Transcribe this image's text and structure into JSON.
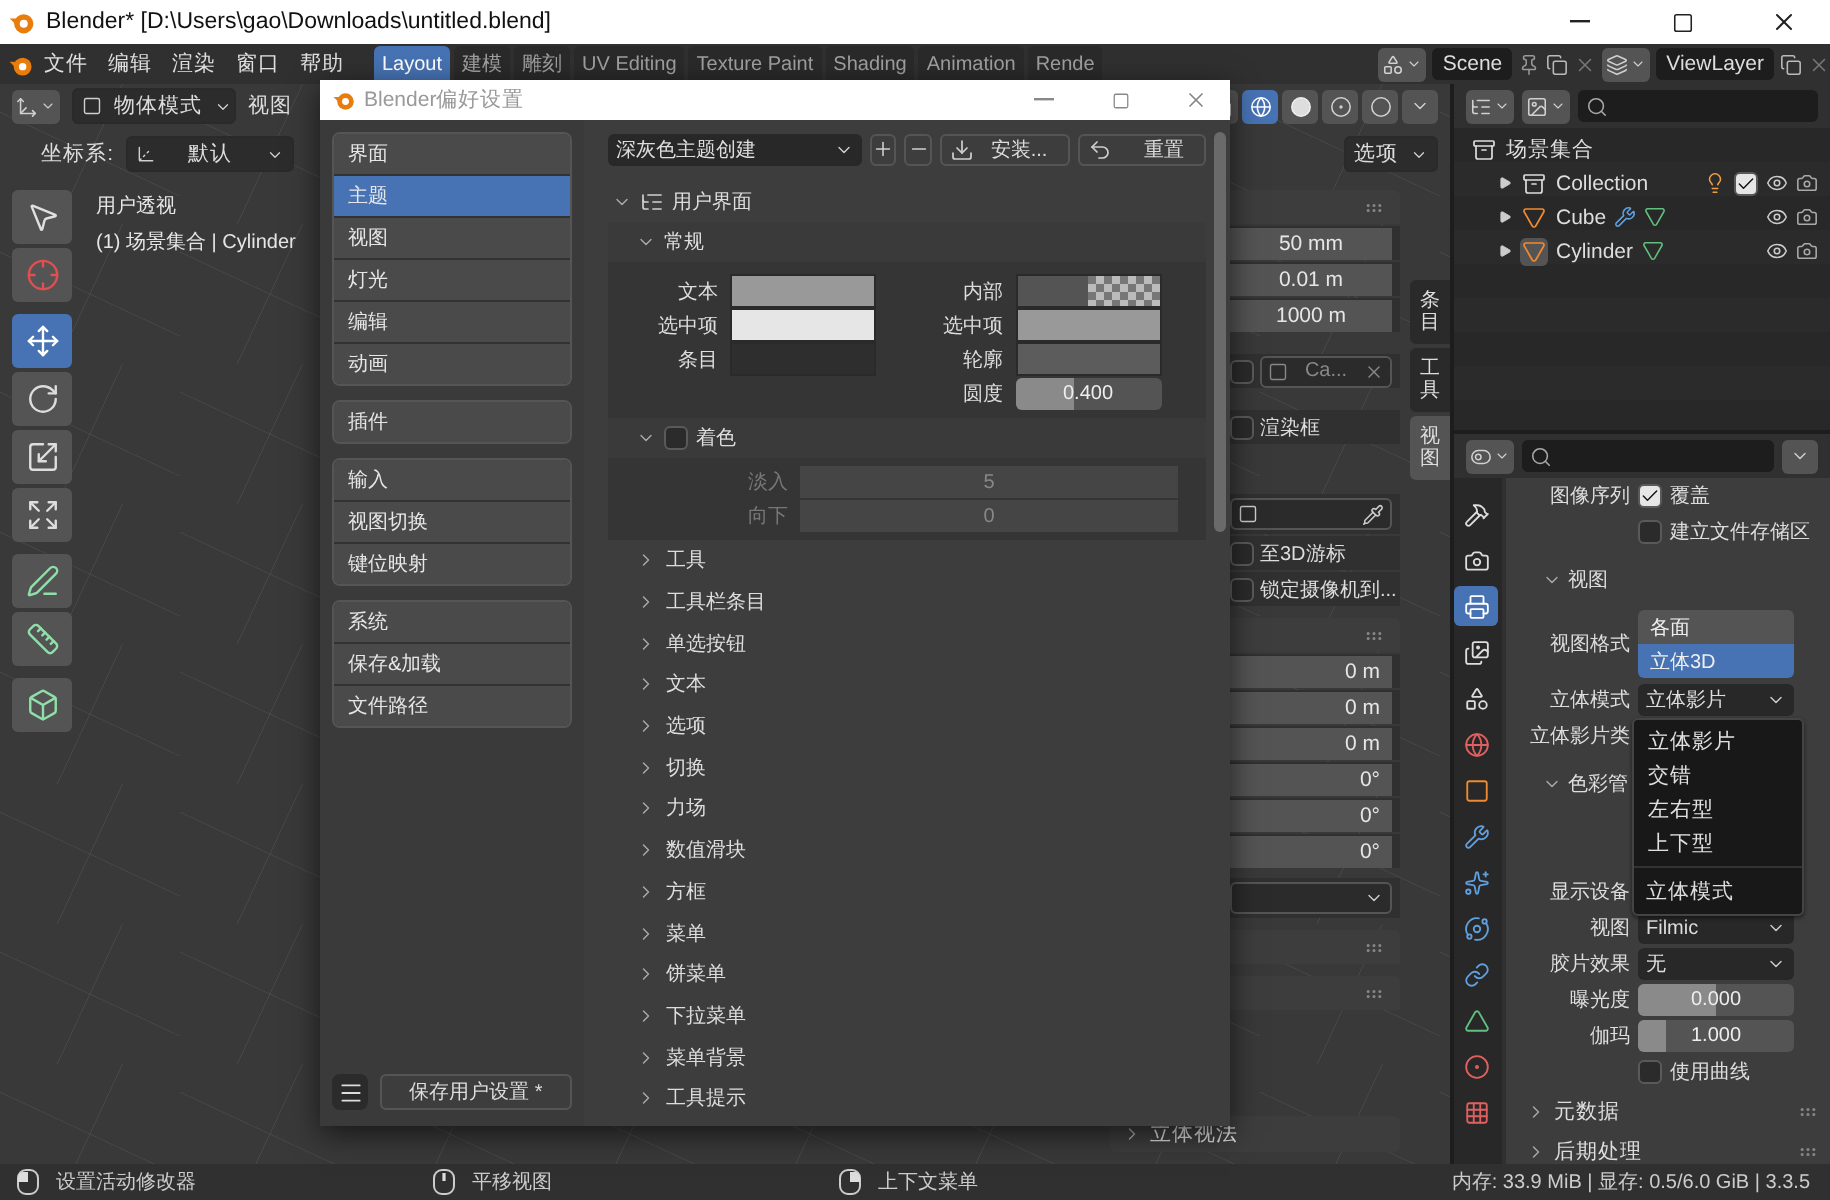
{
  "window": {
    "title": "Blender* [D:\\Users\\gao\\Downloads\\untitled.blend]"
  },
  "menu": [
    {
      "label": "文件"
    },
    {
      "label": "编辑"
    },
    {
      "label": "渲染"
    },
    {
      "label": "窗口"
    },
    {
      "label": "帮助"
    }
  ],
  "workspaces": [
    {
      "label": "Layout",
      "selected": true
    },
    {
      "label": "建模",
      "selected": false
    },
    {
      "label": "雕刻",
      "selected": false
    },
    {
      "label": "UV Editing",
      "selected": false
    },
    {
      "label": "Texture Paint",
      "selected": false
    },
    {
      "label": "Shading",
      "selected": false
    },
    {
      "label": "Animation",
      "selected": false
    },
    {
      "label": "Rende",
      "selected": false
    }
  ],
  "scene": "Scene",
  "view_layer": "ViewLayer",
  "viewport": {
    "mode": "物体模式",
    "view_menu": "视图",
    "coord_label": "坐标系:",
    "coord_value": "默认",
    "options": "选项",
    "tool_groups": [
      [
        {
          "kind": "select",
          "selected": false
        },
        {
          "kind": "cursor",
          "selected": false
        }
      ],
      [
        {
          "kind": "move",
          "selected": true
        },
        {
          "kind": "rotate",
          "selected": false
        },
        {
          "kind": "scale",
          "selected": false
        },
        {
          "kind": "transform",
          "selected": false
        }
      ],
      [
        {
          "kind": "annotate",
          "selected": false
        },
        {
          "kind": "measure",
          "selected": false
        }
      ],
      [
        {
          "kind": "add-cube",
          "selected": false
        }
      ]
    ],
    "overlay": [
      "用户透视",
      "(1) 场景集合 | Cylinder"
    ],
    "sidebar": [
      {
        "kind": "header"
      },
      {
        "kind": "value",
        "value": "50 mm"
      },
      {
        "kind": "value",
        "value": "0.01 m"
      },
      {
        "kind": "value",
        "value": "1000 m"
      },
      {
        "kind": "object",
        "value": "Ca...",
        "checked": false
      },
      {
        "kind": "checkbox",
        "label": "渲染框",
        "checked": false
      },
      {
        "kind": "picker"
      },
      {
        "kind": "checkbox",
        "label": "至3D游标",
        "checked": false
      },
      {
        "kind": "checkbox",
        "label": "锁定摄像机到...",
        "checked": false
      },
      {
        "kind": "header"
      },
      {
        "kind": "value",
        "value": "0 m"
      },
      {
        "kind": "value",
        "value": "0 m"
      },
      {
        "kind": "value",
        "value": "0 m"
      },
      {
        "kind": "value",
        "value": "0°"
      },
      {
        "kind": "value",
        "value": "0°"
      },
      {
        "kind": "value",
        "value": "0°"
      },
      {
        "kind": "dropdown"
      },
      {
        "kind": "header"
      },
      {
        "kind": "header"
      }
    ],
    "stereo_panel": "立体视法",
    "sidebar_tabs": [
      {
        "label": "条目",
        "selected": false
      },
      {
        "label": "工具",
        "selected": false
      },
      {
        "label": "视图",
        "selected": true
      }
    ]
  },
  "outliner": {
    "rows": [
      {
        "label": "场景集合",
        "kind": "scene-collection",
        "active": false
      },
      {
        "label": "Collection",
        "kind": "collection",
        "expanded": false,
        "checked": true,
        "active": false
      },
      {
        "label": "Cube",
        "kind": "mesh",
        "expanded": false,
        "modifier": true,
        "active": false
      },
      {
        "label": "Cylinder",
        "kind": "mesh",
        "expanded": false,
        "modifier": false,
        "active": true
      }
    ]
  },
  "properties": {
    "tabs": [
      {
        "kind": "tool",
        "selected": false
      },
      {
        "kind": "render",
        "selected": false
      },
      {
        "kind": "output",
        "selected": true
      },
      {
        "kind": "view-layer",
        "selected": false
      },
      {
        "kind": "scene",
        "selected": false
      },
      {
        "kind": "world",
        "selected": false
      },
      {
        "kind": "object",
        "selected": false
      },
      {
        "kind": "modifier",
        "selected": false
      },
      {
        "kind": "particles",
        "selected": false
      },
      {
        "kind": "physics",
        "selected": false
      },
      {
        "kind": "constraints",
        "selected": false
      },
      {
        "kind": "data",
        "selected": false
      },
      {
        "kind": "material",
        "selected": false
      },
      {
        "kind": "texture",
        "selected": false
      }
    ],
    "rows": [
      {
        "kind": "checkbox",
        "label": "图像序列",
        "text": "覆盖",
        "checked": true
      },
      {
        "kind": "checkbox",
        "text": "建立文件存储区",
        "checked": false
      },
      {
        "kind": "subpanel",
        "label": "视图",
        "expanded": true
      },
      {
        "kind": "radio",
        "label": "视图格式",
        "options": [
          {
            "label": "各面",
            "selected": false
          },
          {
            "label": "立体3D",
            "selected": true
          }
        ]
      },
      {
        "kind": "dropdown",
        "label": "立体模式",
        "value": "立体影片"
      },
      {
        "kind": "dropdown",
        "label": "立体影片类"
      },
      {
        "kind": "subpanel",
        "label": "色彩管",
        "expanded": true
      },
      {
        "kind": "dropdown",
        "label": "显示设备"
      },
      {
        "kind": "dropdown",
        "label": "视图",
        "value": "Filmic"
      },
      {
        "kind": "dropdown",
        "label": "胶片效果",
        "value": "无"
      },
      {
        "kind": "slider",
        "label": "曝光度",
        "value": "0.000",
        "level": 0.5
      },
      {
        "kind": "slider",
        "label": "伽玛",
        "value": "1.000",
        "level": 0.18
      },
      {
        "kind": "checkbox",
        "text": "使用曲线",
        "checked": false
      },
      {
        "kind": "panel",
        "label": "元数据",
        "expanded": false
      },
      {
        "kind": "panel",
        "label": "后期处理",
        "expanded": false
      }
    ]
  },
  "stereo_menu": {
    "items": [
      "立体影片",
      "交错",
      "左右型",
      "上下型"
    ],
    "title": "立体模式"
  },
  "dialog": {
    "title": "Blender偏好设置",
    "nav_groups": [
      [
        {
          "label": "界面",
          "selected": false
        },
        {
          "label": "主题",
          "selected": true
        },
        {
          "label": "视图",
          "selected": false
        },
        {
          "label": "灯光",
          "selected": false
        },
        {
          "label": "编辑",
          "selected": false
        },
        {
          "label": "动画",
          "selected": false
        }
      ],
      [
        {
          "label": "插件",
          "selected": false
        }
      ],
      [
        {
          "label": "输入",
          "selected": false
        },
        {
          "label": "视图切换",
          "selected": false
        },
        {
          "label": "键位映射",
          "selected": false
        }
      ],
      [
        {
          "label": "系统",
          "selected": false
        },
        {
          "label": "保存&加载",
          "selected": false
        },
        {
          "label": "文件路径",
          "selected": false
        }
      ]
    ],
    "save_button": "保存用户设置 *",
    "preset": "深灰色主题创建",
    "install": "安装...",
    "reset": "重置",
    "section": "用户界面",
    "subsection": "常规",
    "left_colors": [
      {
        "label": "文本",
        "color": "#999999"
      },
      {
        "label": "选中项",
        "color": "#e6e6e6"
      },
      {
        "label": "条目",
        "color": "#2e2e2e"
      }
    ],
    "right_colors": [
      {
        "label": "内部",
        "color": "#545454",
        "transparent": true
      },
      {
        "label": "选中项",
        "color": "#999999",
        "transparent": false
      },
      {
        "label": "轮廓",
        "color": "#5c5c5c",
        "transparent": false
      }
    ],
    "roundness": {
      "label": "圆度",
      "value": "0.400",
      "level": 0.4
    },
    "shading": {
      "label": "着色",
      "checked": false,
      "expanded": true,
      "fields": [
        {
          "label": "淡入",
          "value": "5",
          "disabled": true
        },
        {
          "label": "向下",
          "value": "0",
          "disabled": true
        }
      ]
    },
    "collapsed": [
      "工具",
      "工具栏条目",
      "单选按钮",
      "文本",
      "选项",
      "切换",
      "力场",
      "数值滑块",
      "方框",
      "菜单",
      "饼菜单",
      "下拉菜单",
      "菜单背景",
      "工具提示"
    ]
  },
  "status_bar": {
    "hints": [
      {
        "text": "设置活动修改器",
        "kind": "left"
      },
      {
        "text": "平移视图",
        "kind": "middle"
      },
      {
        "text": "上下文菜单",
        "kind": "right"
      }
    ],
    "stats": "内存: 33.9 MiB | 显存: 0.5/6.0 GiB | 3.3.5"
  }
}
